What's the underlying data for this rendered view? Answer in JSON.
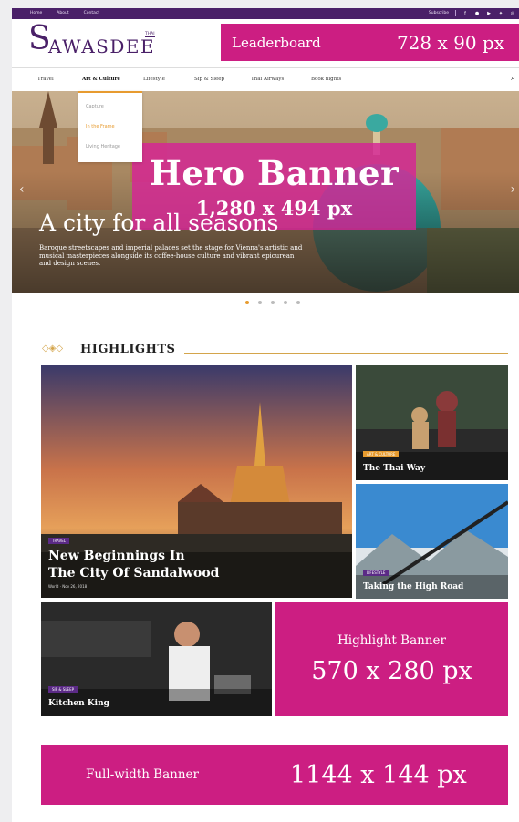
{
  "topbar": {
    "links": [
      "Home",
      "About",
      "Contact"
    ],
    "subscribe": "Subscribe",
    "social_icons": [
      "facebook-icon",
      "line-icon",
      "youtube-icon",
      "twitter-icon",
      "instagram-icon"
    ]
  },
  "header": {
    "logo_first": "S",
    "logo_rest": "AWASDEE",
    "logo_thai": "THAI",
    "leaderboard_label": "Leaderboard",
    "leaderboard_dims": "728 x 90 px"
  },
  "nav": {
    "items": [
      "Travel",
      "Art & Culture",
      "Lifestyle",
      "Sip & Sleep",
      "Thai Airways",
      "Book flights"
    ],
    "active": "Art & Culture",
    "dropdown": [
      "Capture",
      "In the Frame",
      "Living Heritage"
    ]
  },
  "hero": {
    "banner_label": "Hero Banner",
    "banner_dims": "1,280 x 494 px",
    "title": "A city for all seasons",
    "description": "Baroque streetscapes and imperial palaces set the stage for Vienna's artistic and musical masterpieces alongside its coffee-house culture and vibrant epicurean and design scenes.",
    "slides": 5,
    "active_slide": 0
  },
  "highlights": {
    "heading": "HIGHLIGHTS",
    "cards": [
      {
        "tag": "TRAVEL",
        "title_line1": "New Beginnings In",
        "title_line2": "The City Of Sandalwood",
        "meta": "World · Nov 26, 2018"
      },
      {
        "tag": "ART & CULTURE",
        "title": "The Thai Way"
      },
      {
        "tag": "LIFESTYLE",
        "title": "Taking the High Road"
      },
      {
        "tag": "SIP & SLEEP",
        "title": "Kitchen King"
      }
    ],
    "banner_label": "Highlight Banner",
    "banner_dims": "570 x 280 px"
  },
  "fullwidth": {
    "label": "Full-width Banner",
    "dims": "1144 x 144 px"
  },
  "colors": {
    "brand_purple": "#4a2068",
    "banner_magenta": "#cc1e82",
    "accent_gold": "#d4a54b",
    "tag_purple": "#5b2a86",
    "tag_gold": "#e79b2f"
  }
}
